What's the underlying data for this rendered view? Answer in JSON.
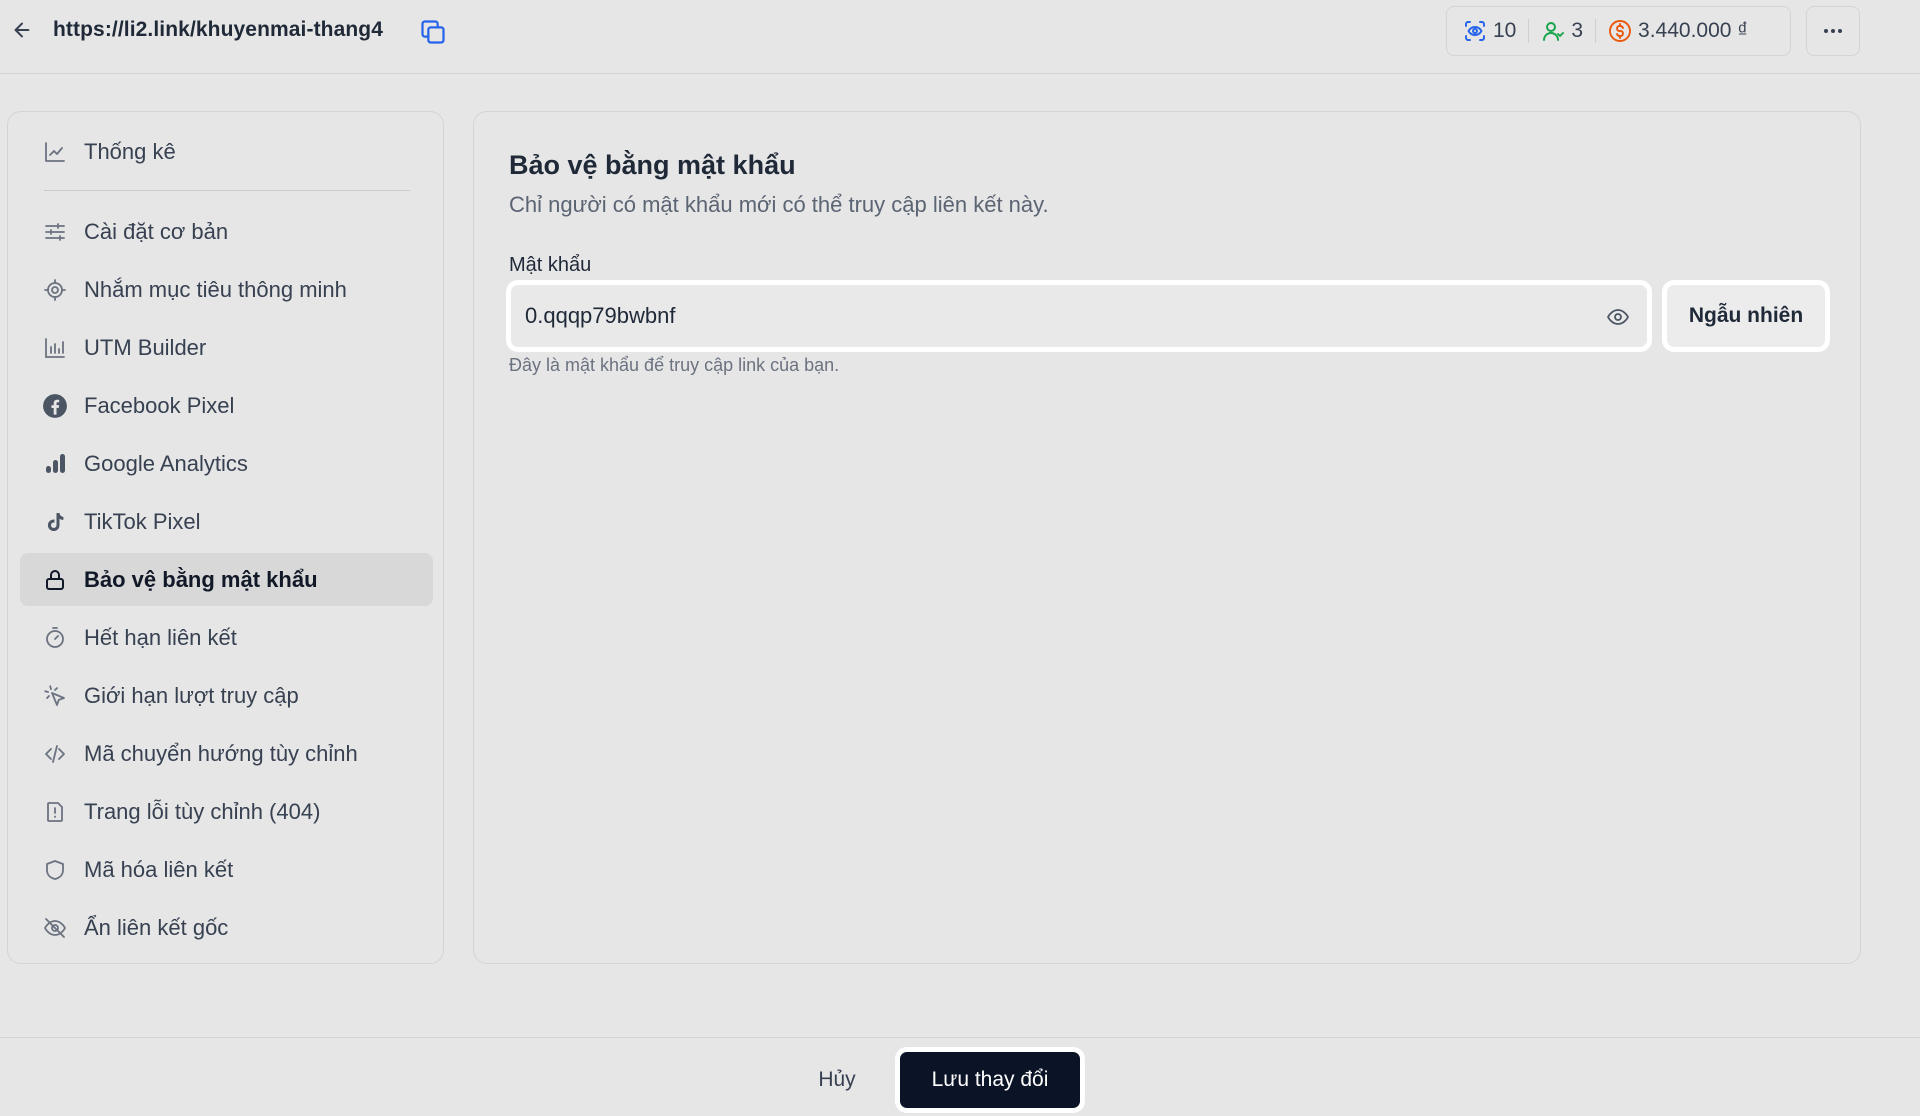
{
  "header": {
    "back_icon": "arrow-left-icon",
    "url": "https://li2.link/khuyenmai-thang4",
    "copy_icon": "copy-icon",
    "stats": {
      "views_icon": "scan-eye-icon",
      "views": "10",
      "users_icon": "user-icon",
      "users": "3",
      "money_icon": "dollar-circle-icon",
      "money": "3.440.000 ₫",
      "money_color": "#ea580c",
      "accent_color": "#2563eb"
    },
    "more_icon": "ellipsis-icon"
  },
  "sidebar": {
    "items": [
      {
        "label": "Thống kê",
        "icon": "chart-line-icon"
      },
      {
        "label": "Cài đặt cơ bản",
        "icon": "sliders-icon"
      },
      {
        "label": "Nhắm mục tiêu thông minh",
        "icon": "target-icon"
      },
      {
        "label": "UTM Builder",
        "icon": "bar-chart-icon"
      },
      {
        "label": "Facebook Pixel",
        "icon": "facebook-icon"
      },
      {
        "label": "Google Analytics",
        "icon": "google-analytics-icon"
      },
      {
        "label": "TikTok Pixel",
        "icon": "tiktok-icon"
      },
      {
        "label": "Bảo vệ bằng mật khẩu",
        "icon": "lock-icon",
        "active": true
      },
      {
        "label": "Hết hạn liên kết",
        "icon": "timer-icon"
      },
      {
        "label": "Giới hạn lượt truy cập",
        "icon": "pointer-click-icon"
      },
      {
        "label": "Mã chuyển hướng tùy chỉnh",
        "icon": "code-icon"
      },
      {
        "label": "Trang lỗi tùy chỉnh (404)",
        "icon": "file-alert-icon"
      },
      {
        "label": "Mã hóa liên kết",
        "icon": "shield-icon"
      },
      {
        "label": "Ẩn liên kết gốc",
        "icon": "eye-off-icon"
      }
    ]
  },
  "main": {
    "title": "Bảo vệ bằng mật khẩu",
    "subtitle": "Chỉ người có mật khẩu mới có thể truy cập liên kết này.",
    "password_label": "Mật khẩu",
    "password_value": "0.qqqp79bwbnf",
    "password_hint": "Đây là mật khẩu để truy cập link của bạn.",
    "random_button": "Ngẫu nhiên"
  },
  "footer": {
    "cancel_label": "Hủy",
    "save_label": "Lưu thay đổi"
  }
}
